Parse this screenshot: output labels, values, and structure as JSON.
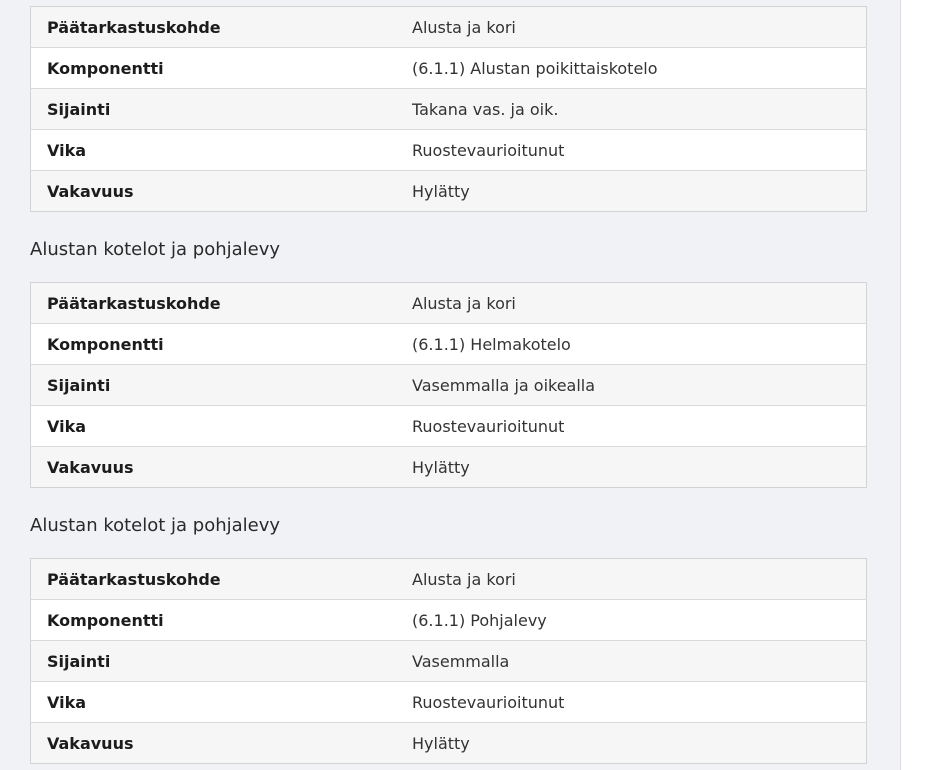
{
  "sections": [
    {
      "title": "",
      "rows": [
        {
          "key": "Päätarkastuskohde",
          "value": "Alusta ja kori"
        },
        {
          "key": "Komponentti",
          "value": "(6.1.1) Alustan poikittaiskotelo"
        },
        {
          "key": "Sijainti",
          "value": "Takana vas. ja oik."
        },
        {
          "key": "Vika",
          "value": "Ruostevaurioitunut"
        },
        {
          "key": "Vakavuus",
          "value": "Hylätty"
        }
      ]
    },
    {
      "title": "Alustan kotelot ja pohjalevy",
      "rows": [
        {
          "key": "Päätarkastuskohde",
          "value": "Alusta ja kori"
        },
        {
          "key": "Komponentti",
          "value": "(6.1.1) Helmakotelo"
        },
        {
          "key": "Sijainti",
          "value": "Vasemmalla ja oikealla"
        },
        {
          "key": "Vika",
          "value": "Ruostevaurioitunut"
        },
        {
          "key": "Vakavuus",
          "value": "Hylätty"
        }
      ]
    },
    {
      "title": "Alustan kotelot ja pohjalevy",
      "rows": [
        {
          "key": "Päätarkastuskohde",
          "value": "Alusta ja kori"
        },
        {
          "key": "Komponentti",
          "value": "(6.1.1) Pohjalevy"
        },
        {
          "key": "Sijainti",
          "value": "Vasemmalla"
        },
        {
          "key": "Vika",
          "value": "Ruostevaurioitunut"
        },
        {
          "key": "Vakavuus",
          "value": "Hylätty"
        }
      ]
    }
  ]
}
